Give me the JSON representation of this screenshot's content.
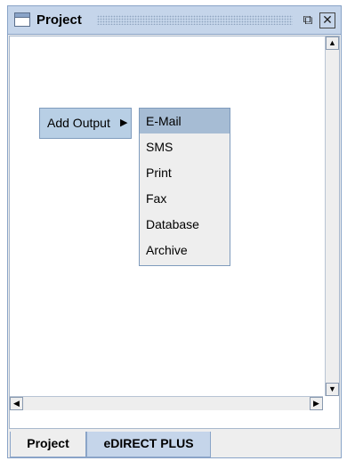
{
  "window": {
    "title": "Project",
    "restore_glyph": "⧉",
    "close_glyph": "✕"
  },
  "context_menu": {
    "item_label": "Add Output",
    "item_arrow": "▶",
    "submenu": [
      {
        "label": "E-Mail",
        "selected": true
      },
      {
        "label": "SMS",
        "selected": false
      },
      {
        "label": "Print",
        "selected": false
      },
      {
        "label": "Fax",
        "selected": false
      },
      {
        "label": "Database",
        "selected": false
      },
      {
        "label": "Archive",
        "selected": false
      }
    ]
  },
  "scrollbars": {
    "up": "▲",
    "down": "▼",
    "left": "◀",
    "right": "▶"
  },
  "tabs": [
    {
      "label": "Project",
      "active": false
    },
    {
      "label": "eDIRECT PLUS",
      "active": true
    }
  ]
}
